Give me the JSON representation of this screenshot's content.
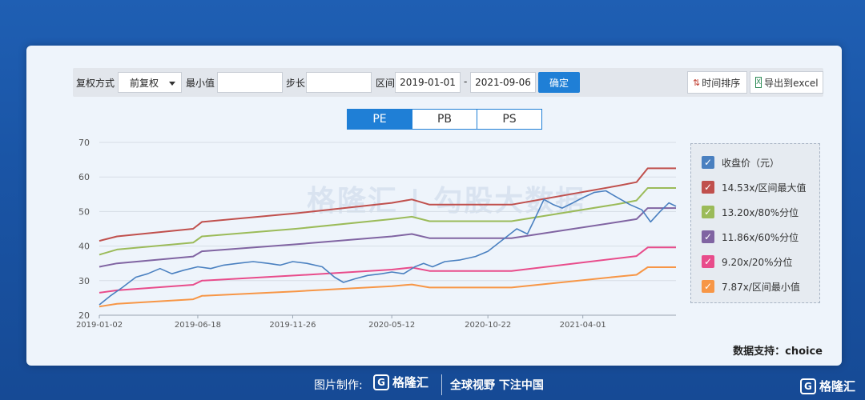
{
  "toolbar": {
    "fq_label": "复权方式",
    "fq_value": "前复权",
    "min_label": "最小值",
    "min_value": "",
    "step_label": "步长",
    "step_value": "",
    "range_label": "区间",
    "start_date": "2019-01-01",
    "dash": "-",
    "end_date": "2021-09-06",
    "confirm_label": "确定",
    "sort_label": "时间排序",
    "export_label": "导出到excel"
  },
  "tabs": [
    {
      "label": "PE",
      "active": true
    },
    {
      "label": "PB",
      "active": false
    },
    {
      "label": "PS",
      "active": false
    }
  ],
  "watermark": "格隆汇 | 勾股大数据",
  "source_text": "数据支持：choice",
  "footer": {
    "credit": "图片制作:",
    "logo_text": "格隆汇",
    "slogan": "全球视野 下注中国",
    "corner_logo": "格隆汇"
  },
  "chart_data": {
    "type": "line",
    "title": "",
    "xlabel": "",
    "ylabel": "",
    "ylim": [
      20,
      70
    ],
    "yticks": [
      20,
      30,
      40,
      50,
      60,
      70
    ],
    "grid": true,
    "legend_position": "right",
    "xlim": [
      "2019-01-02",
      "2021-09-06"
    ],
    "xticks": [
      "2019-01-02",
      "2019-06-18",
      "2019-11-26",
      "2020-05-12",
      "2020-10-22",
      "2021-04-01"
    ],
    "series": [
      {
        "name": "收盘价（元）",
        "color": "#4a80c0",
        "points": [
          [
            "2019-01-02",
            23.0
          ],
          [
            "2019-01-20",
            25.5
          ],
          [
            "2019-02-10",
            28.0
          ],
          [
            "2019-03-05",
            31.0
          ],
          [
            "2019-03-25",
            32.0
          ],
          [
            "2019-04-15",
            33.5
          ],
          [
            "2019-05-05",
            32.0
          ],
          [
            "2019-05-25",
            33.0
          ],
          [
            "2019-06-18",
            34.0
          ],
          [
            "2019-07-10",
            33.5
          ],
          [
            "2019-08-01",
            34.5
          ],
          [
            "2019-08-25",
            35.0
          ],
          [
            "2019-09-20",
            35.5
          ],
          [
            "2019-10-15",
            35.0
          ],
          [
            "2019-11-05",
            34.5
          ],
          [
            "2019-11-26",
            35.5
          ],
          [
            "2019-12-20",
            35.0
          ],
          [
            "2020-01-15",
            34.0
          ],
          [
            "2020-02-05",
            31.0
          ],
          [
            "2020-02-20",
            29.5
          ],
          [
            "2020-03-10",
            30.5
          ],
          [
            "2020-04-01",
            31.5
          ],
          [
            "2020-04-25",
            32.0
          ],
          [
            "2020-05-12",
            32.5
          ],
          [
            "2020-06-01",
            32.0
          ],
          [
            "2020-06-20",
            34.0
          ],
          [
            "2020-07-05",
            35.0
          ],
          [
            "2020-07-20",
            34.0
          ],
          [
            "2020-08-10",
            35.5
          ],
          [
            "2020-09-05",
            36.0
          ],
          [
            "2020-10-01",
            37.0
          ],
          [
            "2020-10-22",
            38.5
          ],
          [
            "2020-11-10",
            41.0
          ],
          [
            "2020-11-25",
            43.0
          ],
          [
            "2020-12-10",
            45.0
          ],
          [
            "2020-12-28",
            43.5
          ],
          [
            "2021-01-10",
            48.0
          ],
          [
            "2021-01-25",
            53.5
          ],
          [
            "2021-02-10",
            52.0
          ],
          [
            "2021-02-25",
            51.0
          ],
          [
            "2021-03-15",
            52.5
          ],
          [
            "2021-04-01",
            54.0
          ],
          [
            "2021-04-20",
            55.5
          ],
          [
            "2021-05-10",
            56.0
          ],
          [
            "2021-05-30",
            54.0
          ],
          [
            "2021-06-20",
            52.0
          ],
          [
            "2021-07-10",
            50.5
          ],
          [
            "2021-07-25",
            47.0
          ],
          [
            "2021-08-10",
            50.0
          ],
          [
            "2021-08-25",
            52.5
          ],
          [
            "2021-09-06",
            51.5
          ]
        ]
      },
      {
        "name": "14.53x/区间最大值",
        "color": "#c0504d",
        "points": [
          [
            "2019-01-02",
            41.5
          ],
          [
            "2019-02-01",
            42.8
          ],
          [
            "2019-06-10",
            45.0
          ],
          [
            "2019-06-25",
            47.0
          ],
          [
            "2019-12-01",
            49.5
          ],
          [
            "2020-05-12",
            52.5
          ],
          [
            "2020-06-15",
            53.5
          ],
          [
            "2020-07-15",
            52.0
          ],
          [
            "2020-12-01",
            52.0
          ],
          [
            "2021-06-01",
            57.5
          ],
          [
            "2021-07-01",
            58.5
          ],
          [
            "2021-07-20",
            62.5
          ],
          [
            "2021-09-06",
            62.5
          ]
        ]
      },
      {
        "name": "13.20x/80%分位",
        "color": "#9bbb59",
        "points": [
          [
            "2019-01-02",
            37.5
          ],
          [
            "2019-02-01",
            39.0
          ],
          [
            "2019-06-10",
            41.0
          ],
          [
            "2019-06-25",
            42.8
          ],
          [
            "2019-12-01",
            45.0
          ],
          [
            "2020-05-12",
            47.8
          ],
          [
            "2020-06-15",
            48.5
          ],
          [
            "2020-07-15",
            47.2
          ],
          [
            "2020-12-01",
            47.2
          ],
          [
            "2021-06-01",
            52.2
          ],
          [
            "2021-07-01",
            53.2
          ],
          [
            "2021-07-20",
            56.8
          ],
          [
            "2021-09-06",
            56.8
          ]
        ]
      },
      {
        "name": "11.86x/60%分位",
        "color": "#8064a2",
        "points": [
          [
            "2019-01-02",
            34.0
          ],
          [
            "2019-02-01",
            35.0
          ],
          [
            "2019-06-10",
            37.0
          ],
          [
            "2019-06-25",
            38.5
          ],
          [
            "2019-12-01",
            40.5
          ],
          [
            "2020-05-12",
            42.8
          ],
          [
            "2020-06-15",
            43.5
          ],
          [
            "2020-07-15",
            42.3
          ],
          [
            "2020-12-01",
            42.3
          ],
          [
            "2021-06-01",
            47.0
          ],
          [
            "2021-07-01",
            47.8
          ],
          [
            "2021-07-20",
            51.0
          ],
          [
            "2021-09-06",
            51.0
          ]
        ]
      },
      {
        "name": "9.20x/20%分位",
        "color": "#e84c8b",
        "points": [
          [
            "2019-01-02",
            26.5
          ],
          [
            "2019-02-01",
            27.2
          ],
          [
            "2019-06-10",
            28.8
          ],
          [
            "2019-06-25",
            30.0
          ],
          [
            "2019-12-01",
            31.5
          ],
          [
            "2020-05-12",
            33.2
          ],
          [
            "2020-06-15",
            33.8
          ],
          [
            "2020-07-15",
            32.8
          ],
          [
            "2020-12-01",
            32.8
          ],
          [
            "2021-06-01",
            36.5
          ],
          [
            "2021-07-01",
            37.1
          ],
          [
            "2021-07-20",
            39.6
          ],
          [
            "2021-09-06",
            39.6
          ]
        ]
      },
      {
        "name": "7.87x/区间最小值",
        "color": "#f79646",
        "points": [
          [
            "2019-01-02",
            22.5
          ],
          [
            "2019-02-01",
            23.3
          ],
          [
            "2019-06-10",
            24.6
          ],
          [
            "2019-06-25",
            25.6
          ],
          [
            "2019-12-01",
            26.9
          ],
          [
            "2020-05-12",
            28.4
          ],
          [
            "2020-06-15",
            28.9
          ],
          [
            "2020-07-15",
            28.0
          ],
          [
            "2020-12-01",
            28.0
          ],
          [
            "2021-06-01",
            31.2
          ],
          [
            "2021-07-01",
            31.7
          ],
          [
            "2021-07-20",
            33.9
          ],
          [
            "2021-09-06",
            33.9
          ]
        ]
      }
    ]
  }
}
